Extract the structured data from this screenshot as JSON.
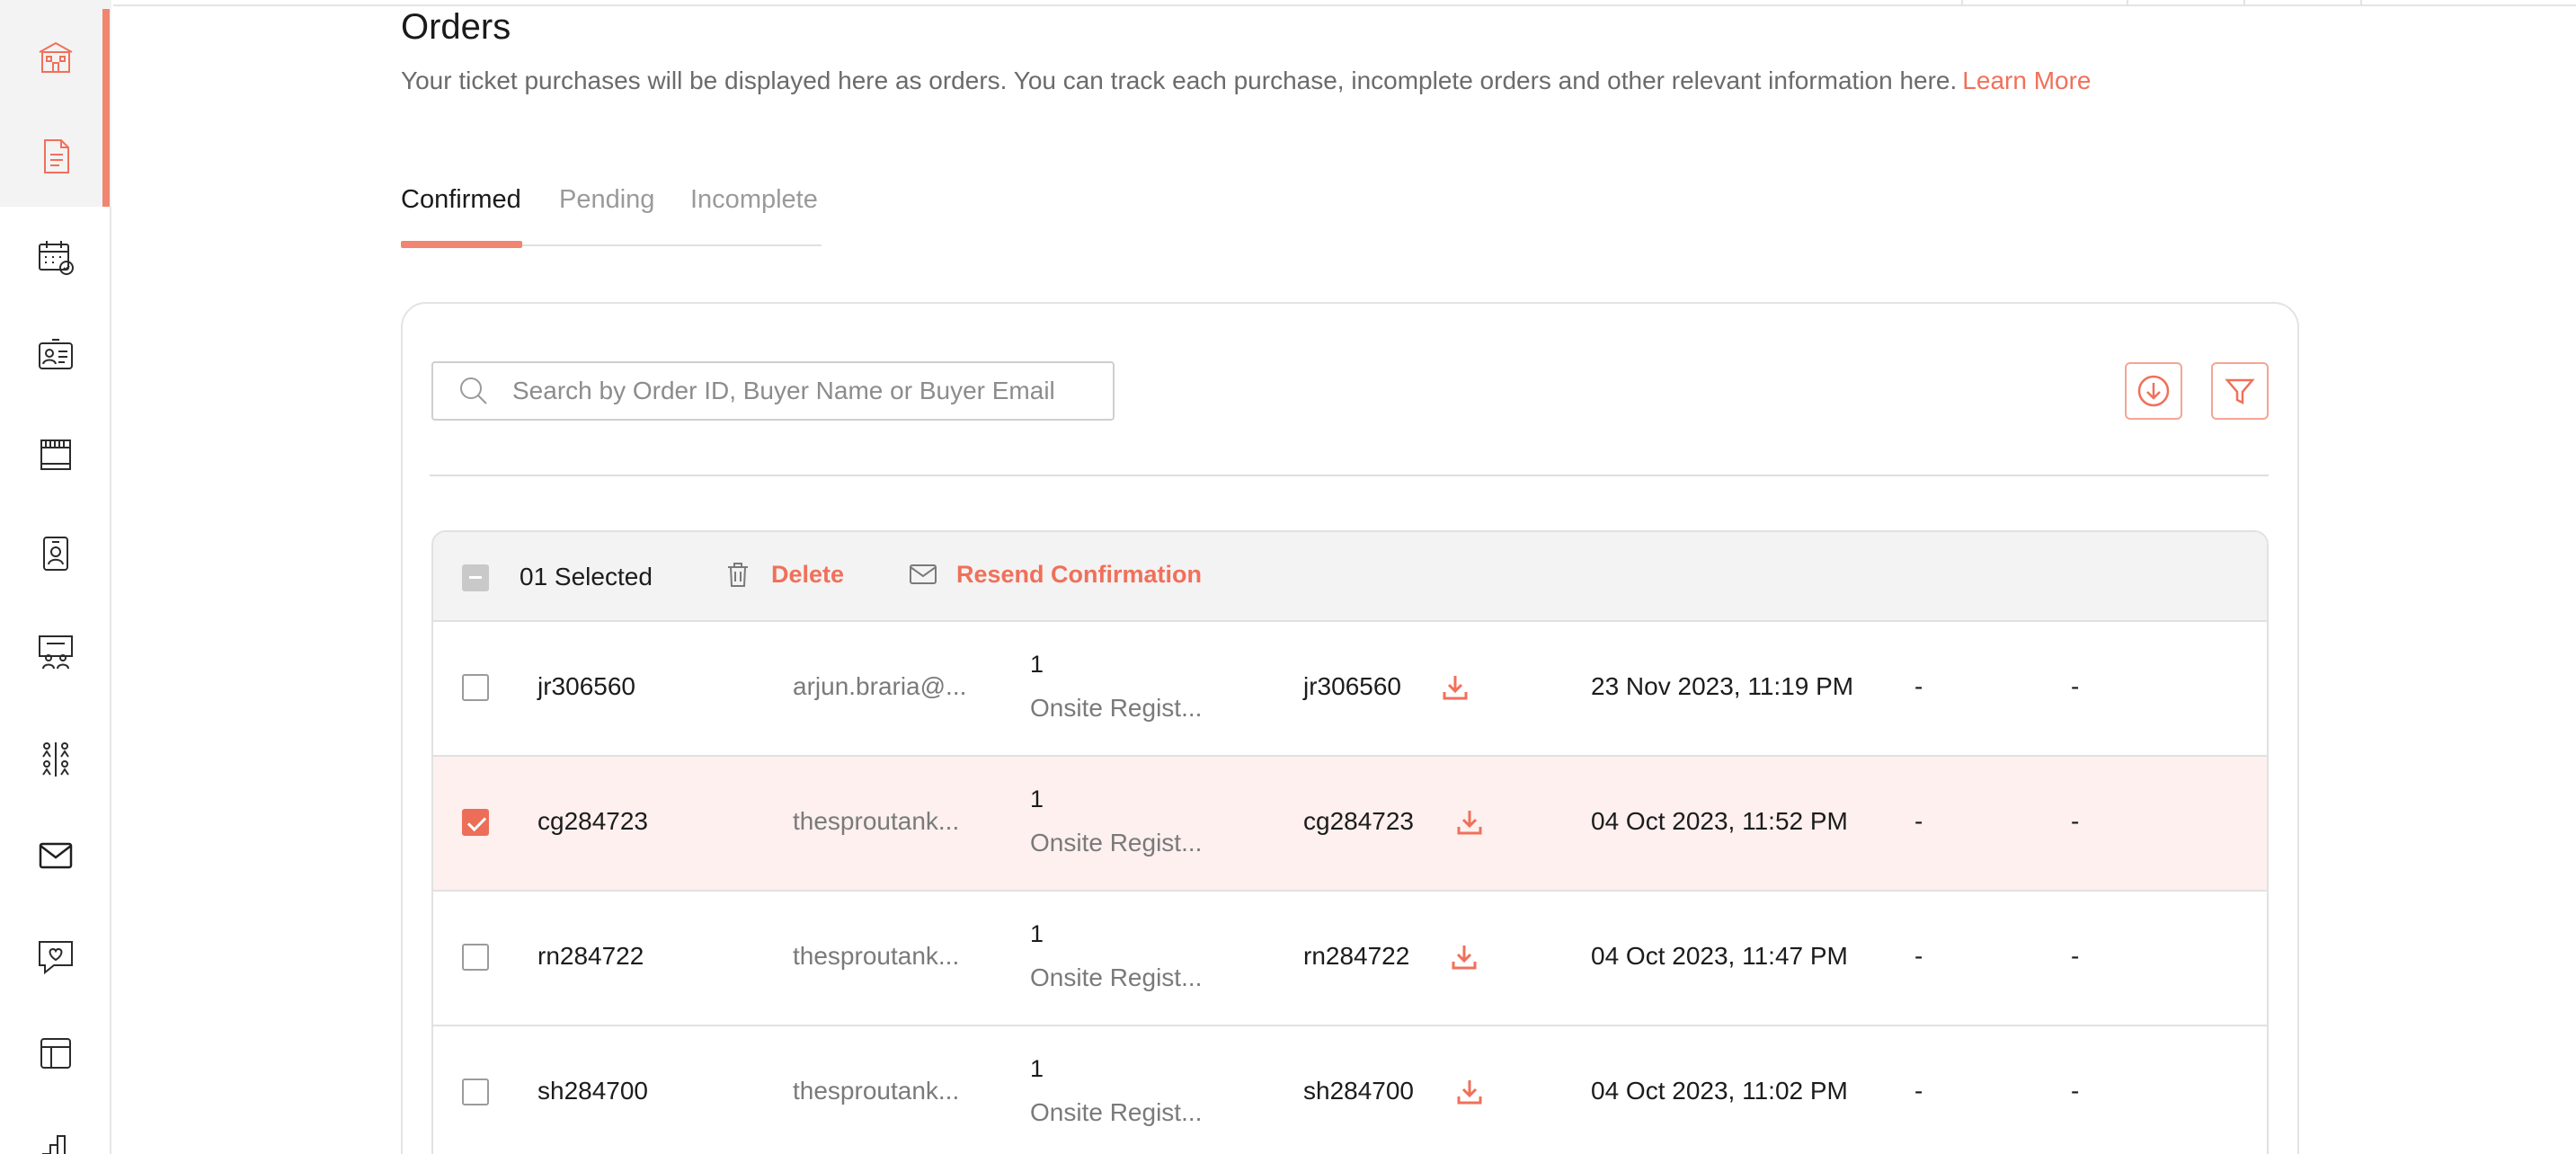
{
  "header": {
    "title": "Orders",
    "description": "Your ticket purchases will be displayed here as orders. You can track each purchase, incomplete orders and other relevant information here.",
    "learn_more": "Learn More"
  },
  "tabs": [
    {
      "label": "Confirmed",
      "active": true
    },
    {
      "label": "Pending",
      "active": false
    },
    {
      "label": "Incomplete",
      "active": false
    }
  ],
  "search": {
    "placeholder": "Search by Order ID, Buyer Name or Buyer Email"
  },
  "toolbar": {
    "download_icon": "download-circle-icon",
    "filter_icon": "filter-icon"
  },
  "bulk": {
    "selected_label": "01 Selected",
    "delete_label": "Delete",
    "resend_label": "Resend Confirmation"
  },
  "orders": [
    {
      "order_id": "jr306560",
      "email": "arjun.braria@...",
      "qty": "1",
      "ticket": "Onsite Regist...",
      "code": "jr306560",
      "date": "23 Nov 2023, 11:19 PM",
      "col7": "-",
      "col8": "-",
      "selected": false
    },
    {
      "order_id": "cg284723",
      "email": "thesproutank...",
      "qty": "1",
      "ticket": "Onsite Regist...",
      "code": "cg284723",
      "date": "04 Oct 2023, 11:52 PM",
      "col7": "-",
      "col8": "-",
      "selected": true
    },
    {
      "order_id": "rn284722",
      "email": "thesproutank...",
      "qty": "1",
      "ticket": "Onsite Regist...",
      "code": "rn284722",
      "date": "04 Oct 2023, 11:47 PM",
      "col7": "-",
      "col8": "-",
      "selected": false
    },
    {
      "order_id": "sh284700",
      "email": "thesproutank...",
      "qty": "1",
      "ticket": "Onsite Regist...",
      "code": "sh284700",
      "date": "04 Oct 2023, 11:02 PM",
      "col7": "-",
      "col8": "-",
      "selected": false
    }
  ],
  "sidebar": {
    "items": [
      "building-icon",
      "document-icon",
      "calendar-check-icon",
      "id-card-icon",
      "booth-icon",
      "badge-icon",
      "presentation-icon",
      "networking-icon",
      "mail-icon",
      "chat-heart-icon",
      "layout-icon",
      "analytics-icon"
    ]
  },
  "colors": {
    "accent": "#f0705a",
    "selected_row": "#fdf0ee"
  }
}
